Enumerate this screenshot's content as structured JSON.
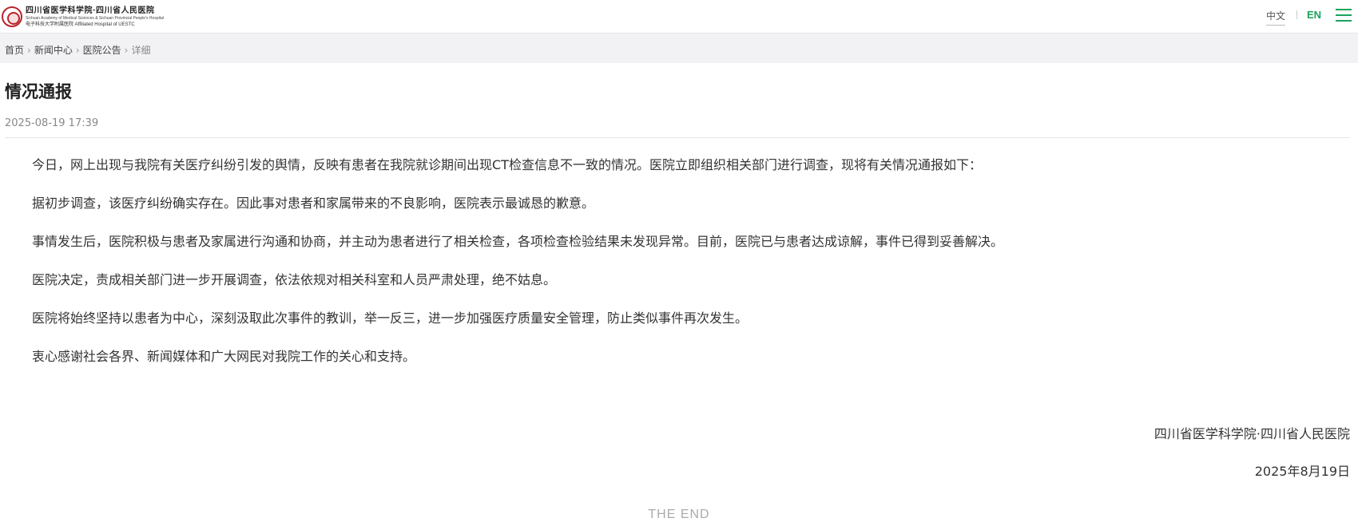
{
  "header": {
    "logo": {
      "name_cn": "四川省医学科学院·四川省人民医院",
      "name_en": "Sichuan Academy of Medical Sciences & Sichuan Provincial People's Hospital",
      "affiliation": "电子科技大学附属医院 Affiliated Hospital of UESTC"
    },
    "lang_cn": "中文",
    "lang_en": "EN",
    "menu_icon": "hamburger-menu-icon"
  },
  "breadcrumb": {
    "items": [
      "首页",
      "新闻中心",
      "医院公告"
    ],
    "current": "详细"
  },
  "article": {
    "title": "情况通报",
    "date": "2025-08-19 17:39",
    "paragraphs": [
      "今日，网上出现与我院有关医疗纠纷引发的舆情，反映有患者在我院就诊期间出现CT检查信息不一致的情况。医院立即组织相关部门进行调查，现将有关情况通报如下：",
      "据初步调查，该医疗纠纷确实存在。因此事对患者和家属带来的不良影响，医院表示最诚恳的歉意。",
      "事情发生后，医院积极与患者及家属进行沟通和协商，并主动为患者进行了相关检查，各项检查检验结果未发现异常。目前，医院已与患者达成谅解，事件已得到妥善解决。",
      "医院决定，责成相关部门进一步开展调查，依法依规对相关科室和人员严肃处理，绝不姑息。",
      "医院将始终坚持以患者为中心，深刻汲取此次事件的教训，举一反三，进一步加强医疗质量安全管理，防止类似事件再次发生。",
      "衷心感谢社会各界、新闻媒体和广大网民对我院工作的关心和支持。"
    ],
    "signature": "四川省医学科学院·四川省人民医院",
    "sign_date": "2025年8月19日",
    "end_text": "THE END"
  },
  "colors": {
    "accent": "#19a35a",
    "logo_red": "#b8242b",
    "crumb_bg": "#f2f2f4"
  }
}
